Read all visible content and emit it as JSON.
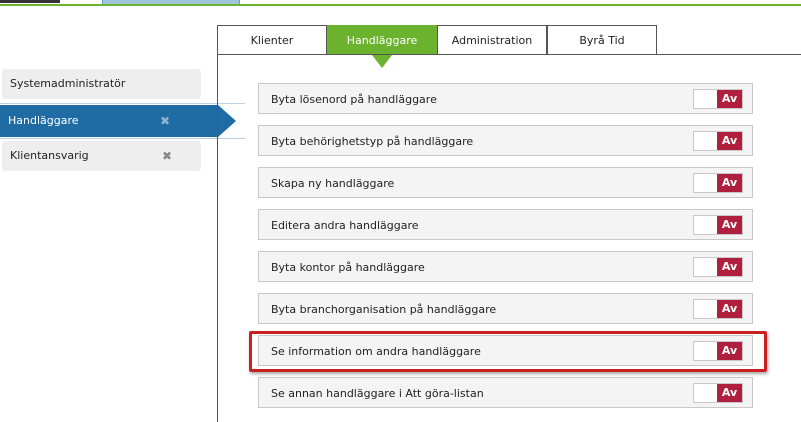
{
  "sidebar": {
    "items": [
      {
        "label": "Systemadministratör",
        "removable": false,
        "active": false
      },
      {
        "label": "Handläggare",
        "removable": true,
        "active": true
      },
      {
        "label": "Klientansvarig",
        "removable": true,
        "active": false
      }
    ],
    "remove_glyph": "✖"
  },
  "tabs": [
    {
      "label": "Klienter",
      "active": false
    },
    {
      "label": "Handläggare",
      "active": true
    },
    {
      "label": "Administration",
      "active": false
    },
    {
      "label": "Byrå Tid",
      "active": false
    }
  ],
  "permissions": [
    {
      "label": "Byta lösenord på handläggare",
      "state": "Av"
    },
    {
      "label": "Byta behörighetstyp på handläggare",
      "state": "Av"
    },
    {
      "label": "Skapa ny handläggare",
      "state": "Av"
    },
    {
      "label": "Editera andra handläggare",
      "state": "Av"
    },
    {
      "label": "Byta kontor på handläggare",
      "state": "Av"
    },
    {
      "label": "Byta branchorganisation på handläggare",
      "state": "Av"
    },
    {
      "label": "Se information om andra handläggare",
      "state": "Av",
      "highlighted": true
    },
    {
      "label": "Se annan handläggare i Att göra-listan",
      "state": "Av"
    }
  ],
  "colors": {
    "accent_green": "#6bb32e",
    "active_blue": "#1f6ca5",
    "toggle_off_red": "#b0203e",
    "highlight_red": "#cc1f1f"
  },
  "icons": {
    "remove": "close-x-icon",
    "sidebar_pointer": "arrow-right-icon",
    "tab_pointer": "arrow-down-icon"
  }
}
